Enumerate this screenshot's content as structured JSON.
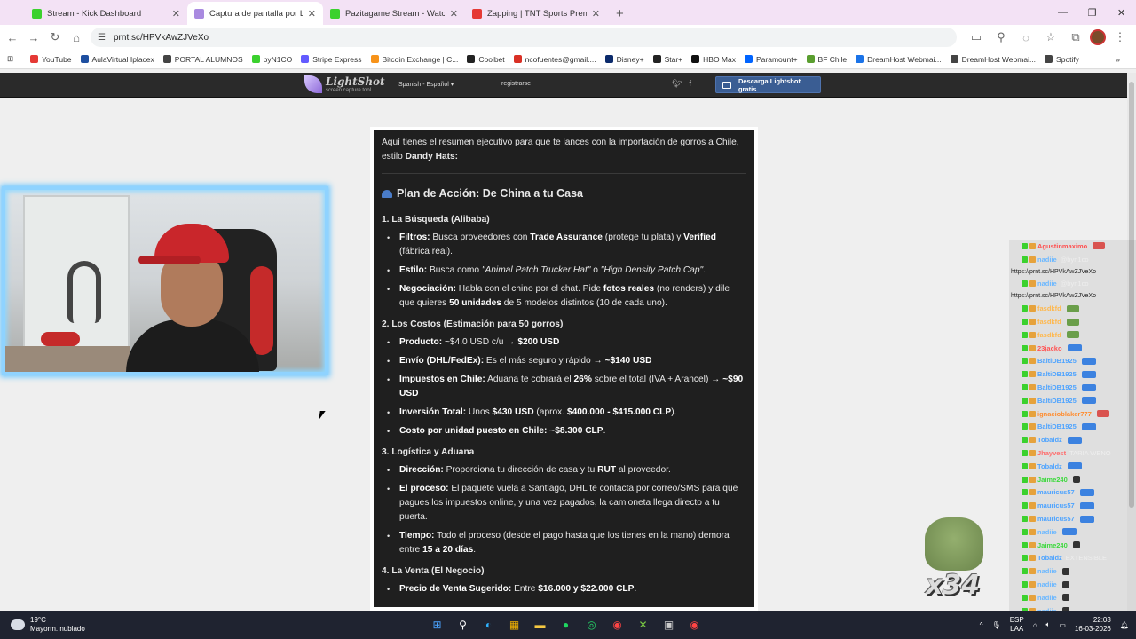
{
  "tabs": [
    {
      "label": "Stream - Kick Dashboard",
      "icon": "kick-icon",
      "active": false
    },
    {
      "label": "Captura de pantalla por Lightshot",
      "icon": "lightshot-icon",
      "active": true
    },
    {
      "label": "Pazitagame Stream - Watch Live",
      "icon": "kick-icon",
      "active": false
    },
    {
      "label": "Zapping | TNT Sports Premium",
      "icon": "tnt-icon",
      "active": false
    }
  ],
  "address": {
    "url": "prnt.sc/HPVkAwZJVeXo"
  },
  "bookmarks": [
    {
      "label": "YouTube",
      "color": "#e53935"
    },
    {
      "label": "AulaVirtual Iplacex",
      "color": "#1e4fa0"
    },
    {
      "label": "PORTAL ALUMNOS",
      "color": "#444444"
    },
    {
      "label": "byN1CO",
      "color": "#3bd12e"
    },
    {
      "label": "Stripe Express",
      "color": "#635bff"
    },
    {
      "label": "Bitcoin Exchange | C...",
      "color": "#f7931a"
    },
    {
      "label": "Coolbet",
      "color": "#222222"
    },
    {
      "label": "ncofuentes@gmail....",
      "color": "#d93025"
    },
    {
      "label": "Disney+",
      "color": "#0b2a6b"
    },
    {
      "label": "Star+",
      "color": "#222222"
    },
    {
      "label": "HBO Max",
      "color": "#111111"
    },
    {
      "label": "Paramount+",
      "color": "#0064ff"
    },
    {
      "label": "BF Chile",
      "color": "#5a9e2f"
    },
    {
      "label": "DreamHost Webmai...",
      "color": "#1a73e8"
    },
    {
      "label": "DreamHost Webmai...",
      "color": "#444444"
    },
    {
      "label": "Spotify",
      "color": "#444444"
    }
  ],
  "lightshot": {
    "brand": "LightShot",
    "tagline": "screen capture tool",
    "language": "Spanish - Español",
    "register": "registrarse",
    "download": "Descarga Lightshot gratis"
  },
  "doc": {
    "intro_a": "Aquí tienes el resumen ejecutivo para que te lances con la importación de gorros a Chile, estilo ",
    "intro_b": "Dandy Hats:",
    "plan_title": "Plan de Acción: De China a tu Casa",
    "sections": [
      {
        "title": "1. La Búsqueda (Alibaba)",
        "items": [
          [
            {
              "t": "Filtros:",
              "b": true
            },
            {
              "t": " Busca proveedores con "
            },
            {
              "t": "Trade Assurance",
              "b": true
            },
            {
              "t": " (protege tu plata) y "
            },
            {
              "t": "Verified",
              "b": true
            },
            {
              "t": " (fábrica real)."
            }
          ],
          [
            {
              "t": "Estilo:",
              "b": true
            },
            {
              "t": " Busca como "
            },
            {
              "t": "\"Animal Patch Trucker Hat\"",
              "i": true
            },
            {
              "t": " o "
            },
            {
              "t": "\"High Density Patch Cap\"",
              "i": true
            },
            {
              "t": "."
            }
          ],
          [
            {
              "t": "Negociación:",
              "b": true
            },
            {
              "t": " Habla con el chino por el chat. Pide "
            },
            {
              "t": "fotos reales",
              "b": true
            },
            {
              "t": " (no renders) y dile que quieres "
            },
            {
              "t": "50 unidades",
              "b": true
            },
            {
              "t": " de 5 modelos distintos (10 de cada uno)."
            }
          ]
        ]
      },
      {
        "title": "2. Los Costos (Estimación para 50 gorros)",
        "items": [
          [
            {
              "t": "Producto:",
              "b": true
            },
            {
              "t": " ~$4.0 USD c/u → "
            },
            {
              "t": "$200 USD",
              "b": true
            }
          ],
          [
            {
              "t": "Envío (DHL/FedEx):",
              "b": true
            },
            {
              "t": " Es el más seguro y rápido → "
            },
            {
              "t": "~$140 USD",
              "b": true
            }
          ],
          [
            {
              "t": "Impuestos en Chile:",
              "b": true
            },
            {
              "t": " Aduana te cobrará el "
            },
            {
              "t": "26%",
              "b": true
            },
            {
              "t": " sobre el total (IVA + Arancel) → "
            },
            {
              "t": "~$90 USD",
              "b": true
            }
          ],
          [
            {
              "t": "Inversión Total:",
              "b": true
            },
            {
              "t": " Unos "
            },
            {
              "t": "$430 USD",
              "b": true
            },
            {
              "t": " (aprox. "
            },
            {
              "t": "$400.000 - $415.000 CLP",
              "b": true
            },
            {
              "t": ")."
            }
          ],
          [
            {
              "t": "Costo por unidad puesto en Chile:",
              "b": true
            },
            {
              "t": " "
            },
            {
              "t": "~$8.300 CLP",
              "b": true
            },
            {
              "t": "."
            }
          ]
        ]
      },
      {
        "title": "3. Logística y Aduana",
        "items": [
          [
            {
              "t": "Dirección:",
              "b": true
            },
            {
              "t": " Proporciona tu dirección de casa y tu "
            },
            {
              "t": "RUT",
              "b": true
            },
            {
              "t": " al proveedor."
            }
          ],
          [
            {
              "t": "El proceso:",
              "b": true
            },
            {
              "t": " El paquete vuela a Santiago, DHL te contacta por correo/SMS para que pagues los impuestos online, y una vez pagados, la camioneta llega directo a tu puerta."
            }
          ],
          [
            {
              "t": "Tiempo:",
              "b": true
            },
            {
              "t": " Todo el proceso (desde el pago hasta que los tienes en la mano) demora entre "
            },
            {
              "t": "15 a 20 días",
              "b": true
            },
            {
              "t": "."
            }
          ]
        ]
      },
      {
        "title": "4. La Venta (El Negocio)",
        "items": [
          [
            {
              "t": "Precio de Venta Sugerido:",
              "b": true
            },
            {
              "t": " Entre "
            },
            {
              "t": "$16.000 y $22.000 CLP",
              "b": true
            },
            {
              "t": "."
            }
          ]
        ]
      }
    ]
  },
  "chat": {
    "rows": [
      {
        "user": "Agustinmaximo",
        "color": "#ff5050",
        "msg": "",
        "emote": "red"
      },
      {
        "user": "nadiie",
        "color": "#6cb8ff",
        "msg": "@byn1co",
        "emote": ""
      },
      {
        "link": "https://prnt.sc/HPVkAwZJVeXo"
      },
      {
        "user": "nadiie",
        "color": "#6cb8ff",
        "msg": "@byn1co",
        "emote": ""
      },
      {
        "link": "https://prnt.sc/HPVkAwZJVeXo"
      },
      {
        "user": "fasdkfd",
        "color": "#ffb84d",
        "msg": "",
        "emote": "green"
      },
      {
        "user": "fasdkfd",
        "color": "#ffb84d",
        "msg": "",
        "emote": "green"
      },
      {
        "user": "fasdkfd",
        "color": "#ffb84d",
        "msg": "",
        "emote": "green"
      },
      {
        "user": "23jacko",
        "color": "#ff5555",
        "msg": "",
        "emote": "blue"
      },
      {
        "user": "BaltiDB1925",
        "color": "#4da3ff",
        "msg": "",
        "emote": "blue"
      },
      {
        "user": "BaltiDB1925",
        "color": "#4da3ff",
        "msg": "",
        "emote": "blue"
      },
      {
        "user": "BaltiDB1925",
        "color": "#4da3ff",
        "msg": "",
        "emote": "blue"
      },
      {
        "user": "BaltiDB1925",
        "color": "#4da3ff",
        "msg": "",
        "emote": "blue"
      },
      {
        "user": "ignacioblaker777",
        "color": "#ff8c2e",
        "msg": "",
        "emote": "red"
      },
      {
        "user": "BaltiDB1925",
        "color": "#4da3ff",
        "msg": "",
        "emote": "blue"
      },
      {
        "user": "Tobaldz",
        "color": "#4da3ff",
        "msg": "",
        "emote": "blue"
      },
      {
        "user": "Jhayvest",
        "color": "#ff6b6b",
        "msg": "TARIA WENO",
        "emote": ""
      },
      {
        "user": "Tobaldz",
        "color": "#4da3ff",
        "msg": "",
        "emote": "blue"
      },
      {
        "user": "Jaime240",
        "color": "#3cd93c",
        "msg": "",
        "emote": "dark"
      },
      {
        "user": "mauricus57",
        "color": "#4da3ff",
        "msg": "",
        "emote": "blue"
      },
      {
        "user": "mauricus57",
        "color": "#4da3ff",
        "msg": "",
        "emote": "blue"
      },
      {
        "user": "mauricus57",
        "color": "#4da3ff",
        "msg": "",
        "emote": "blue"
      },
      {
        "user": "nadiie",
        "color": "#6cb8ff",
        "msg": "",
        "emote": "blue"
      },
      {
        "user": "Jaime240",
        "color": "#3cd93c",
        "msg": "",
        "emote": "dark"
      },
      {
        "user": "Tobaldz",
        "color": "#4da3ff",
        "msg": "EXTENSIBLE",
        "emote": ""
      },
      {
        "user": "nadiie",
        "color": "#6cb8ff",
        "msg": "",
        "emote": "dark"
      },
      {
        "user": "nadiie",
        "color": "#6cb8ff",
        "msg": "",
        "emote": "dark"
      },
      {
        "user": "nadiie",
        "color": "#6cb8ff",
        "msg": "",
        "emote": "dark"
      },
      {
        "user": "nadiie",
        "color": "#6cb8ff",
        "msg": "",
        "emote": "dark"
      }
    ],
    "multiplier": "x34"
  },
  "taskbar": {
    "temp": "19°C",
    "weather": "Mayorm. nublado",
    "lang1": "ESP",
    "lang2": "LAA",
    "time": "22:03",
    "date": "16-03-2026"
  }
}
